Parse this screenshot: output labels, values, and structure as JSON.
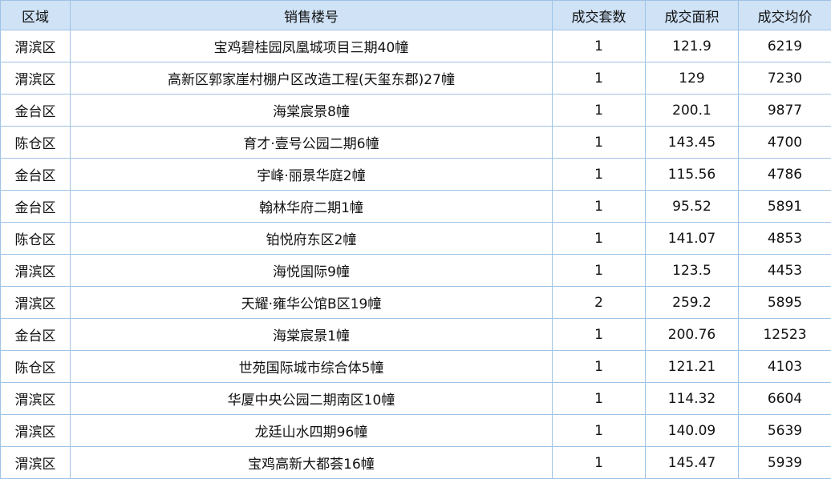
{
  "table": {
    "columns": [
      "区域",
      "销售楼号",
      "成交套数",
      "成交面积",
      "成交均价"
    ],
    "rows": [
      {
        "area": "渭滨区",
        "name": "宝鸡碧桂园凤凰城项目三期40幢",
        "units": "1",
        "size": "121.9",
        "price": "6219"
      },
      {
        "area": "渭滨区",
        "name": "高新区郭家崖村棚户区改造工程(天玺东郡)27幢",
        "units": "1",
        "size": "129",
        "price": "7230"
      },
      {
        "area": "金台区",
        "name": "海棠宸景8幢",
        "units": "1",
        "size": "200.1",
        "price": "9877"
      },
      {
        "area": "陈仓区",
        "name": "育才·壹号公园二期6幢",
        "units": "1",
        "size": "143.45",
        "price": "4700"
      },
      {
        "area": "金台区",
        "name": "宇峰·丽景华庭2幢",
        "units": "1",
        "size": "115.56",
        "price": "4786"
      },
      {
        "area": "金台区",
        "name": "翰林华府二期1幢",
        "units": "1",
        "size": "95.52",
        "price": "5891"
      },
      {
        "area": "陈仓区",
        "name": "铂悦府东区2幢",
        "units": "1",
        "size": "141.07",
        "price": "4853"
      },
      {
        "area": "渭滨区",
        "name": "海悦国际9幢",
        "units": "1",
        "size": "123.5",
        "price": "4453"
      },
      {
        "area": "渭滨区",
        "name": "天耀·雍华公馆B区19幢",
        "units": "2",
        "size": "259.2",
        "price": "5895"
      },
      {
        "area": "金台区",
        "name": "海棠宸景1幢",
        "units": "1",
        "size": "200.76",
        "price": "12523"
      },
      {
        "area": "陈仓区",
        "name": "世苑国际城市综合体5幢",
        "units": "1",
        "size": "121.21",
        "price": "4103"
      },
      {
        "area": "渭滨区",
        "name": "华厦中央公园二期南区10幢",
        "units": "1",
        "size": "114.32",
        "price": "6604"
      },
      {
        "area": "渭滨区",
        "name": "龙廷山水四期96幢",
        "units": "1",
        "size": "140.09",
        "price": "5639"
      },
      {
        "area": "渭滨区",
        "name": "宝鸡高新大都荟16幢",
        "units": "1",
        "size": "145.47",
        "price": "5939"
      }
    ]
  }
}
